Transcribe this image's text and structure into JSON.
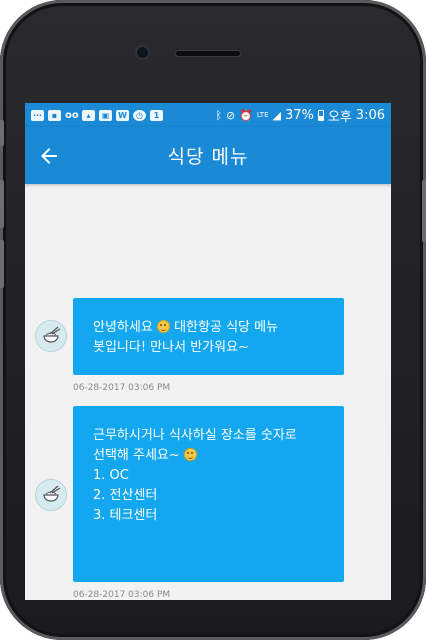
{
  "status_bar": {
    "battery": "37%",
    "time_period": "오후",
    "time": "3:06",
    "left_icons": [
      "chat-icon",
      "app-badge-icon",
      "binoculars-icon",
      "image-icon",
      "store-icon",
      "word-icon",
      "alarm-icon",
      "notification-icon"
    ],
    "right_icons": [
      "bluetooth-icon",
      "mute-icon",
      "alarm-clock-icon",
      "lte-icon",
      "signal-icon",
      "battery-icon"
    ]
  },
  "app_bar": {
    "title": "식당 메뉴",
    "back_icon": "back-arrow-icon"
  },
  "messages": [
    {
      "lines": [
        "안녕하세요",
        "대한항공 식당 메뉴",
        "봇입니다! 만나서 반가워요~"
      ],
      "timestamp": "06-28-2017 03:06 PM"
    },
    {
      "lines": [
        "근무하시거나 식사하실 장소를 숫자로",
        "선택해 주세요~"
      ],
      "options": [
        "1. OC",
        "2. 전산센터",
        "3. 테크센터"
      ],
      "timestamp": "06-28-2017 03:06 PM"
    }
  ],
  "colors": {
    "accent": "#1a8ad7",
    "bubble": "#12a7ee",
    "chat_background": "#f2f2f2"
  }
}
